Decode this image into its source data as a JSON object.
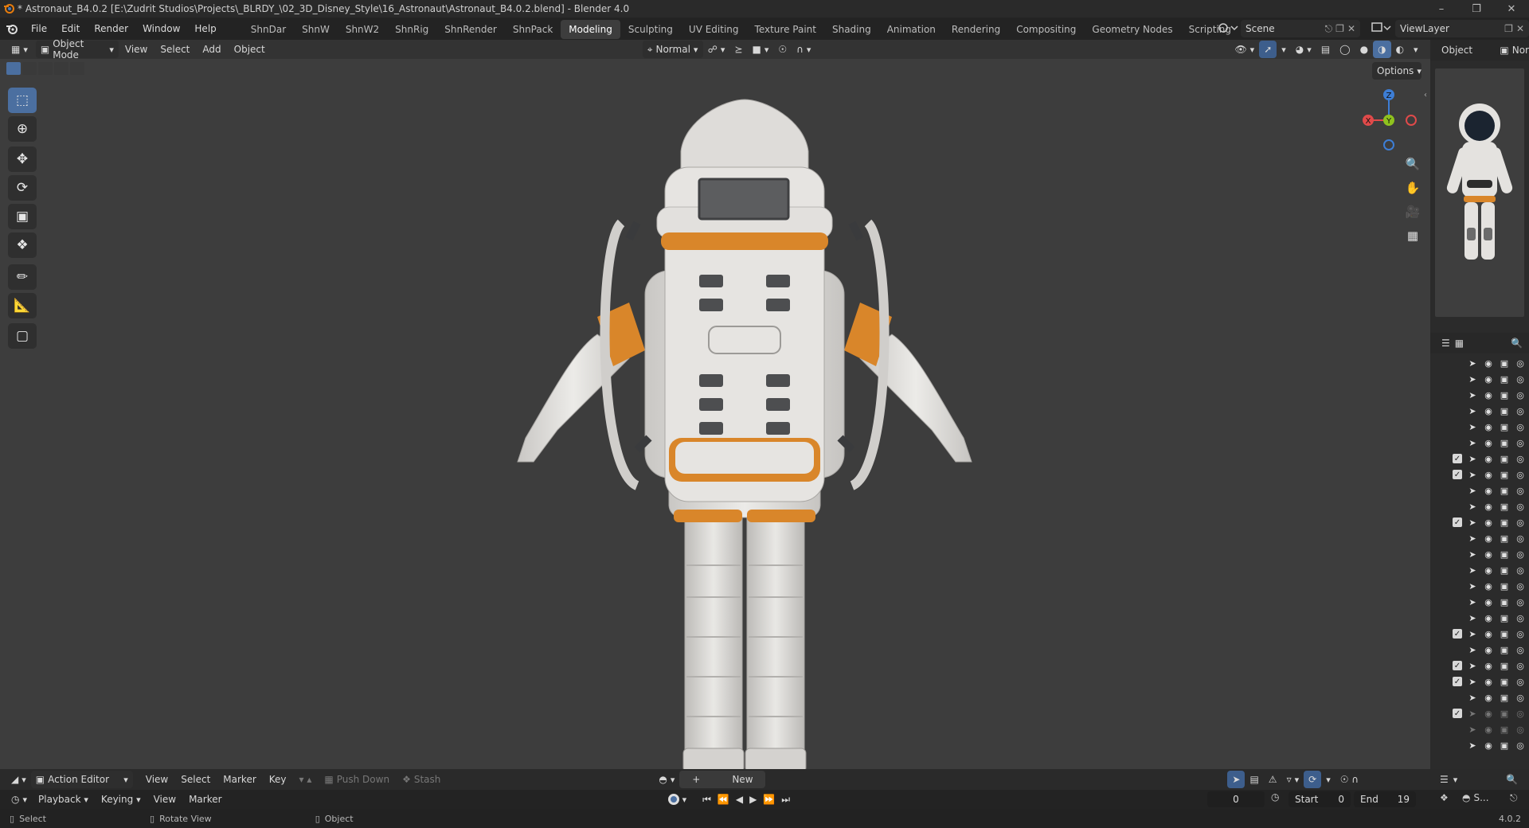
{
  "titlebar": {
    "title": "* Astronaut_B4.0.2 [E:\\Zudrit Studios\\Projects\\_BLRDY_\\02_3D_Disney_Style\\16_Astronaut\\Astronaut_B4.0.2.blend] - Blender 4.0"
  },
  "menu": {
    "items": [
      "File",
      "Edit",
      "Render",
      "Window",
      "Help"
    ]
  },
  "workspaces": {
    "tabs": [
      "ShnDar",
      "ShnW",
      "ShnW2",
      "ShnRig",
      "ShnRender",
      "ShnPack",
      "Modeling",
      "Sculpting",
      "UV Editing",
      "Texture Paint",
      "Shading",
      "Animation",
      "Rendering",
      "Compositing",
      "Geometry Nodes",
      "Scripting"
    ],
    "active": "Modeling",
    "add_icon": "plus-icon"
  },
  "scene": {
    "name": "Scene",
    "view_layer": "ViewLayer"
  },
  "viewport_header": {
    "mode": "Object Mode",
    "menus": [
      "View",
      "Select",
      "Add",
      "Object"
    ],
    "orientation": "Normal",
    "options_label": "Options"
  },
  "right_panel": {
    "tab_object": "Object",
    "tab_other": "Nor"
  },
  "gizmo": {
    "x": "X",
    "y": "Y",
    "z": "Z",
    "colors": {
      "x": "#e04a4a",
      "y": "#8fc21e",
      "z": "#3d7ed6"
    }
  },
  "action_editor": {
    "mode": "Action Editor",
    "menus": [
      "View",
      "Select",
      "Marker",
      "Key"
    ],
    "push_down": "Push Down",
    "stash": "Stash",
    "new_label": "New"
  },
  "timeline": {
    "menus": [
      "Playback",
      "Keying",
      "View",
      "Marker"
    ],
    "current_frame": "0",
    "start_label": "Start",
    "start": "0",
    "end_label": "End",
    "end": "19",
    "scene_abbrev": "S..."
  },
  "statusbar": {
    "select": "Select",
    "rotate": "Rotate View",
    "object": "Object",
    "version": "4.0.2"
  },
  "colors": {
    "accent": "#4b6fa0",
    "suit_white": "#e4e2df",
    "suit_orange": "#d9862a",
    "viewport_bg": "#3d3d3d"
  }
}
